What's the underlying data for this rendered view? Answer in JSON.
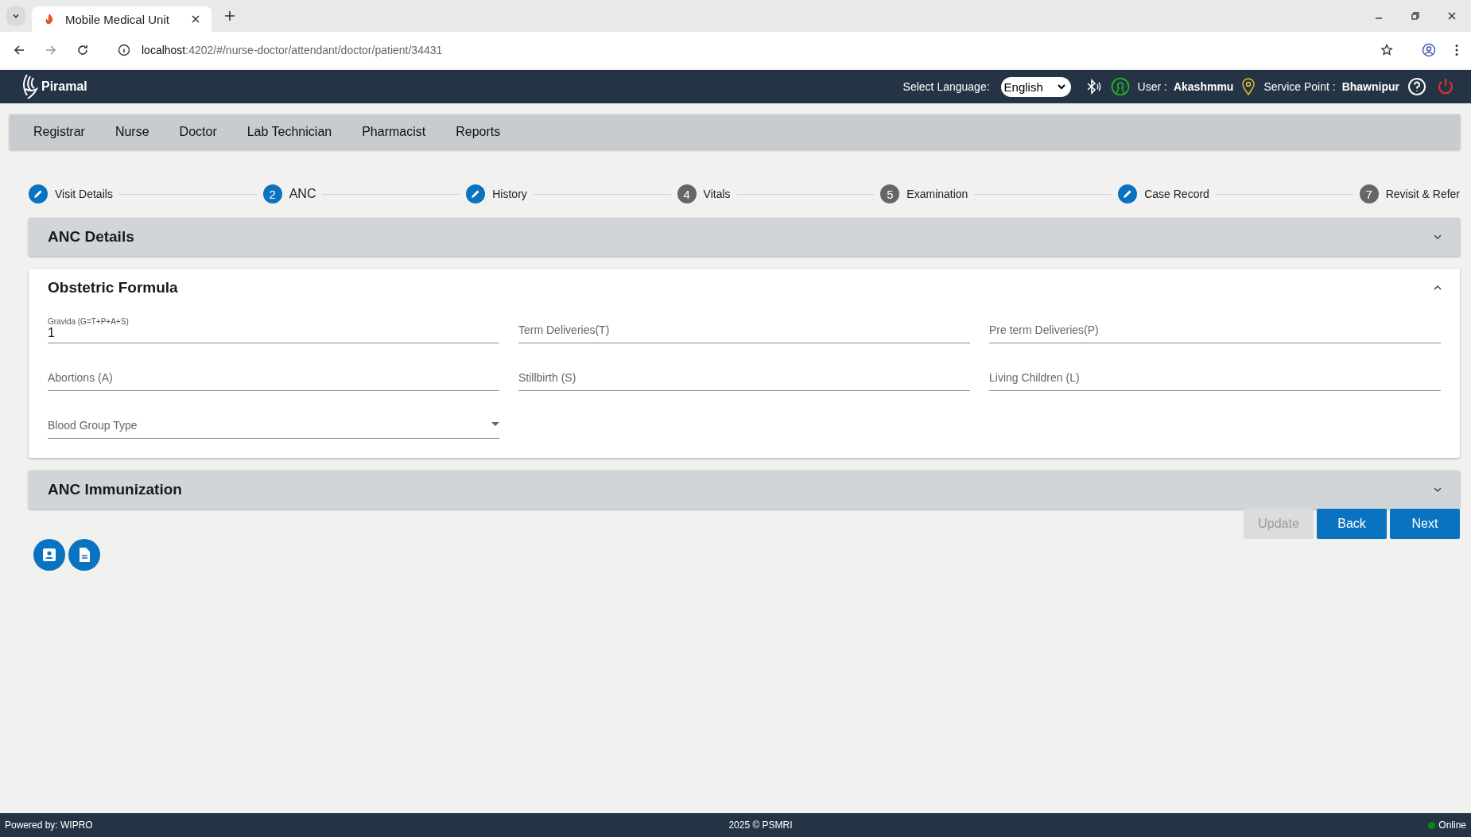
{
  "browser": {
    "tab_title": "Mobile Medical Unit",
    "url": "**localhost**:4202/#/nurse-doctor/attendant/doctor/patient/34431"
  },
  "header": {
    "brand": "Piramal",
    "language_label": "Select Language:",
    "language": "English",
    "user_label": "User :",
    "user": "Akashmmu",
    "service_point_label": "Service Point :",
    "service_point": "Bhawnipur"
  },
  "nav": [
    "Registrar",
    "Nurse",
    "Doctor",
    "Lab Technician",
    "Pharmacist",
    "Reports"
  ],
  "steps": [
    {
      "kind": "edit",
      "label": "Visit Details",
      "selected": false
    },
    {
      "kind": "number",
      "number": "2",
      "label": "ANC",
      "selected": true
    },
    {
      "kind": "edit",
      "label": "History",
      "selected": false
    },
    {
      "kind": "number",
      "number": "4",
      "label": "Vitals",
      "selected": false
    },
    {
      "kind": "number",
      "number": "5",
      "label": "Examination",
      "selected": false
    },
    {
      "kind": "edit",
      "label": "Case Record",
      "selected": false
    },
    {
      "kind": "number",
      "number": "7",
      "label": "Revisit & Refer",
      "selected": false
    }
  ],
  "panels": [
    {
      "title": "ANC Details",
      "expanded": false
    },
    {
      "title": "Obstetric Formula",
      "expanded": true,
      "fields": [
        {
          "kind": "text",
          "label": "Gravida (G=T+P+A+S)",
          "value": "1"
        },
        {
          "kind": "text",
          "label": "Term Deliveries(T)"
        },
        {
          "kind": "text",
          "label": "Pre term Deliveries(P)"
        },
        {
          "kind": "text",
          "label": "Abortions (A)"
        },
        {
          "kind": "text",
          "label": "Stillbirth (S)"
        },
        {
          "kind": "text",
          "label": "Living Children (L)"
        },
        {
          "kind": "select",
          "label": "Blood Group Type"
        }
      ]
    },
    {
      "title": "ANC Immunization",
      "expanded": false
    }
  ],
  "buttons": [
    {
      "label": "Update",
      "disabled": true
    },
    {
      "label": "Back",
      "disabled": false
    },
    {
      "label": "Next",
      "disabled": false
    }
  ],
  "footer": {
    "left": "Powered by: WIPRO",
    "center": "2025 © PSMRI",
    "status": "Online",
    "online": true
  }
}
